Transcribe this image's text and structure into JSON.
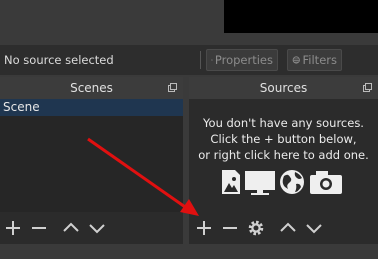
{
  "status": {
    "no_source": "No source selected"
  },
  "source_toolbar": {
    "properties_label": "Properties",
    "filters_label": "Filters"
  },
  "scenes": {
    "title": "Scenes",
    "items": [
      {
        "label": "Scene"
      }
    ]
  },
  "sources": {
    "title": "Sources",
    "empty_lines": [
      "You don't have any sources.",
      "Click the + button below,",
      "or right click here to add one."
    ]
  },
  "icons": {
    "properties": "gear-icon",
    "filters": "filter-icon",
    "add": "plus-icon",
    "remove": "minus-icon",
    "settings": "gear-icon",
    "up": "chevron-up-icon",
    "down": "chevron-down-icon",
    "undock": "undock-icon",
    "image": "image-icon",
    "display": "monitor-icon",
    "browser": "globe-icon",
    "camera": "camera-icon"
  },
  "colors": {
    "annotation_arrow": "#e01010",
    "selection": "#1f3650"
  }
}
